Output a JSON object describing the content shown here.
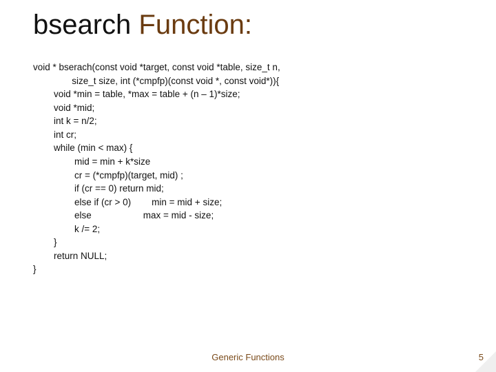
{
  "title": {
    "part1": "bsearch ",
    "part2": "Function:"
  },
  "code": {
    "l1": "void * bserach(const void *target, const void *table, size_t n,",
    "l2": "               size_t size, int (*cmpfp)(const void *, const void*)){",
    "l3": "        void *min = table, *max = table + (n – 1)*size;",
    "l4": "        void *mid;",
    "l5": "        int k = n/2;",
    "l6": "        int cr;",
    "l7": "        while (min < max) {",
    "l8": "                mid = min + k*size",
    "l9": "                cr = (*cmpfp)(target, mid) ;",
    "l10": "                if (cr == 0) return mid;",
    "l11": "                else if (cr > 0)        min = mid + size;",
    "l12": "                else                    max = mid - size;",
    "l13": "                k /= 2;",
    "l14": "        }",
    "l15": "        return NULL;",
    "l16": "}"
  },
  "footer": {
    "label": "Generic Functions",
    "page": "5"
  }
}
